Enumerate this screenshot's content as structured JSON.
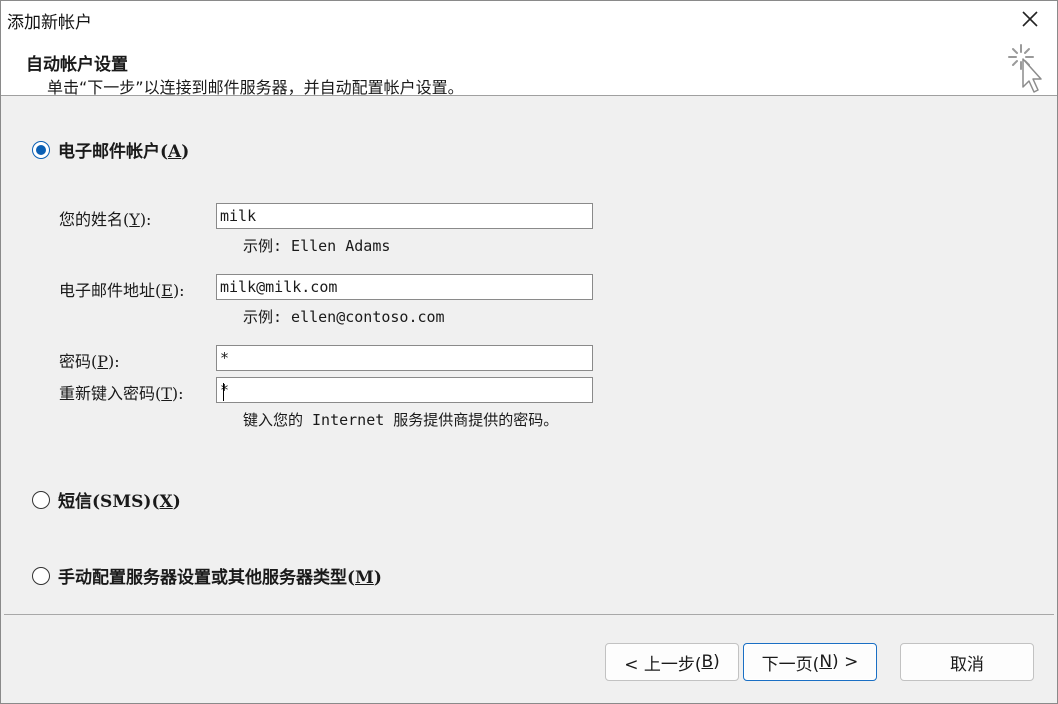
{
  "window": {
    "title": "添加新帐户"
  },
  "header": {
    "title": "自动帐户设置",
    "subtitle": "单击“下一步”以连接到邮件服务器，并自动配置帐户设置。"
  },
  "options": {
    "email": {
      "label": "电子邮件帐户(",
      "key": "A",
      "suffix": ")",
      "selected": true
    },
    "sms": {
      "label": "短信(SMS)(",
      "key": "X",
      "suffix": ")",
      "selected": false
    },
    "manual": {
      "label": "手动配置服务器设置或其他服务器类型(",
      "key": "M",
      "suffix": ")",
      "selected": false
    }
  },
  "form": {
    "name": {
      "label": "您的姓名(",
      "key": "Y",
      "suffix": "):",
      "value": "milk",
      "hint": "示例: Ellen Adams"
    },
    "email": {
      "label": "电子邮件地址(",
      "key": "E",
      "suffix": "):",
      "value": "milk@milk.com",
      "hint": "示例: ellen@contoso.com"
    },
    "password": {
      "label": "密码(",
      "key": "P",
      "suffix": "):",
      "value": "*"
    },
    "retype": {
      "label": "重新键入密码(",
      "key": "T",
      "suffix": "):",
      "value": "*",
      "hint": "键入您的 Internet 服务提供商提供的密码。"
    }
  },
  "buttons": {
    "back": {
      "prefix": "< 上一步(",
      "key": "B",
      "suffix": ")"
    },
    "next": {
      "prefix": "下一页(",
      "key": "N",
      "suffix": ") >"
    },
    "cancel": {
      "label": "取消"
    }
  },
  "colors": {
    "accent": "#0a5fb4",
    "dialog_bg": "#f0f0f0",
    "header_bg": "#ffffff"
  },
  "icons": {
    "close": "close-icon",
    "wizard": "cursor-sparkle-icon"
  }
}
